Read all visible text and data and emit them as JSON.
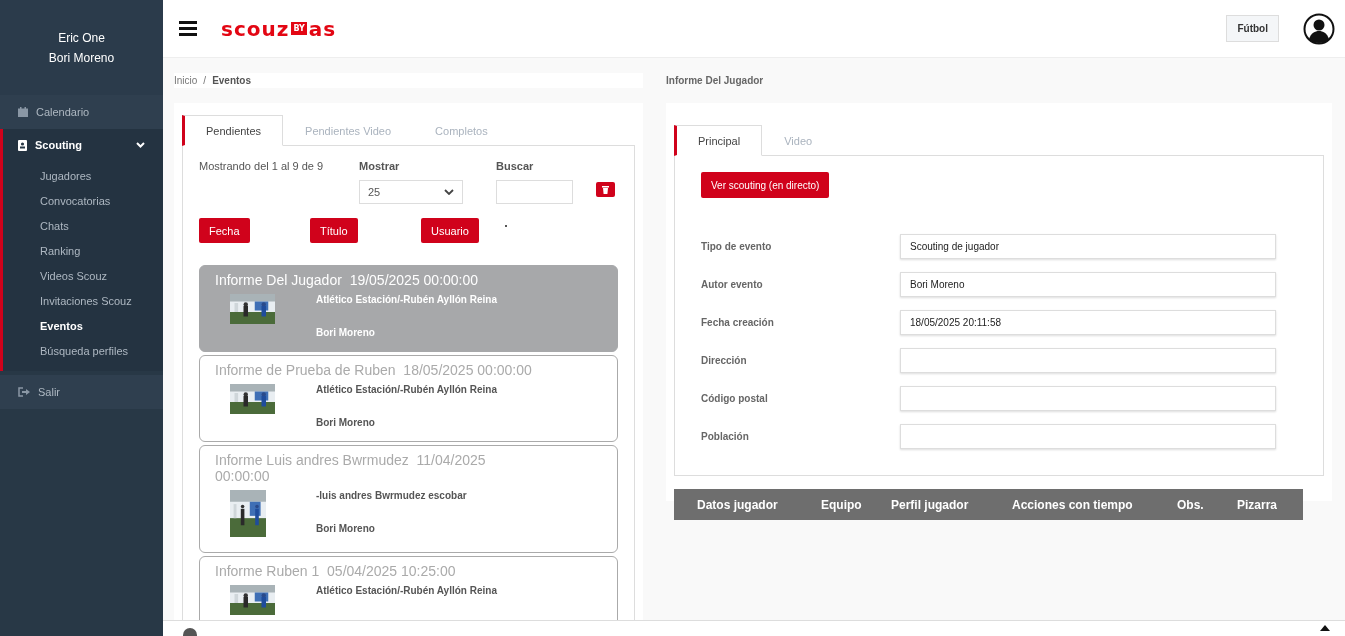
{
  "sidebar": {
    "user_lines": [
      "Eric One",
      "Bori Moreno"
    ],
    "items": [
      {
        "label": "Calendario",
        "selected": false
      },
      {
        "label": "Scouting",
        "selected": true,
        "expanded": true,
        "children": [
          {
            "label": "Jugadores",
            "selected": false
          },
          {
            "label": "Convocatorias",
            "selected": false
          },
          {
            "label": "Chats",
            "selected": false
          },
          {
            "label": "Ranking",
            "selected": false
          },
          {
            "label": "Videos Scouz",
            "selected": false
          },
          {
            "label": "Invitaciones Scouz",
            "selected": false
          },
          {
            "label": "Eventos",
            "selected": true
          },
          {
            "label": "Búsqueda perfiles",
            "selected": false
          }
        ]
      },
      {
        "label": "Salir",
        "selected": false
      }
    ]
  },
  "header": {
    "logo": {
      "main": "scouz",
      "tag": "BY",
      "brand": "as"
    },
    "sport_button": "Fútbol"
  },
  "breadcrumb": {
    "items": [
      "Inicio",
      "Eventos"
    ],
    "separator": "/"
  },
  "events_panel": {
    "tabs": [
      {
        "label": "Pendientes",
        "selected": true
      },
      {
        "label": "Pendientes Video",
        "selected": false
      },
      {
        "label": "Completos",
        "selected": false
      }
    ],
    "showing": "Mostrando del 1 al 9 de 9",
    "show_label": "Mostrar",
    "show_value": "25",
    "search_label": "Buscar",
    "sort_buttons": [
      "Fecha",
      "Título",
      "Usuario"
    ],
    "events": [
      {
        "title": "Informe Del Jugador",
        "date": "19/05/2025 00:00:00",
        "team": "Atlético Estación/-Rubén Ayllón Reina",
        "user": "Bori Moreno",
        "selected": true,
        "portrait": false
      },
      {
        "title": "Informe de Prueba de Ruben",
        "date": "18/05/2025 00:00:00",
        "team": "Atlético Estación/-Rubén Ayllón Reina",
        "user": "Bori Moreno",
        "selected": false,
        "portrait": false
      },
      {
        "title": "Informe Luis andres Bwrmudez",
        "date": "11/04/2025 00:00:00",
        "team": "-luis andres Bwrmudez escobar",
        "user": "Bori Moreno",
        "selected": false,
        "portrait": true
      },
      {
        "title": "Informe Ruben 1",
        "date": "05/04/2025 10:25:00",
        "team": "Atlético Estación/-Rubén Ayllón Reina",
        "selected": false,
        "portrait": false
      }
    ]
  },
  "report": {
    "title": "Informe Del Jugador",
    "tabs": [
      {
        "label": "Principal",
        "selected": true
      },
      {
        "label": "Video",
        "selected": false
      }
    ],
    "live_button": "Ver scouting (en directo)",
    "fields": [
      {
        "label": "Tipo de evento",
        "value": "Scouting de jugador"
      },
      {
        "label": "Autor evento",
        "value": "Bori Moreno"
      },
      {
        "label": "Fecha creación",
        "value": "18/05/2025 20:11:58"
      },
      {
        "label": "Dirección"
      },
      {
        "label": "Código postal"
      },
      {
        "label": "Población"
      }
    ],
    "table_columns": [
      "Datos jugador",
      "Equipo",
      "Perfil jugador",
      "Acciones con tiempo",
      "Obs.",
      "Pizarra"
    ]
  }
}
